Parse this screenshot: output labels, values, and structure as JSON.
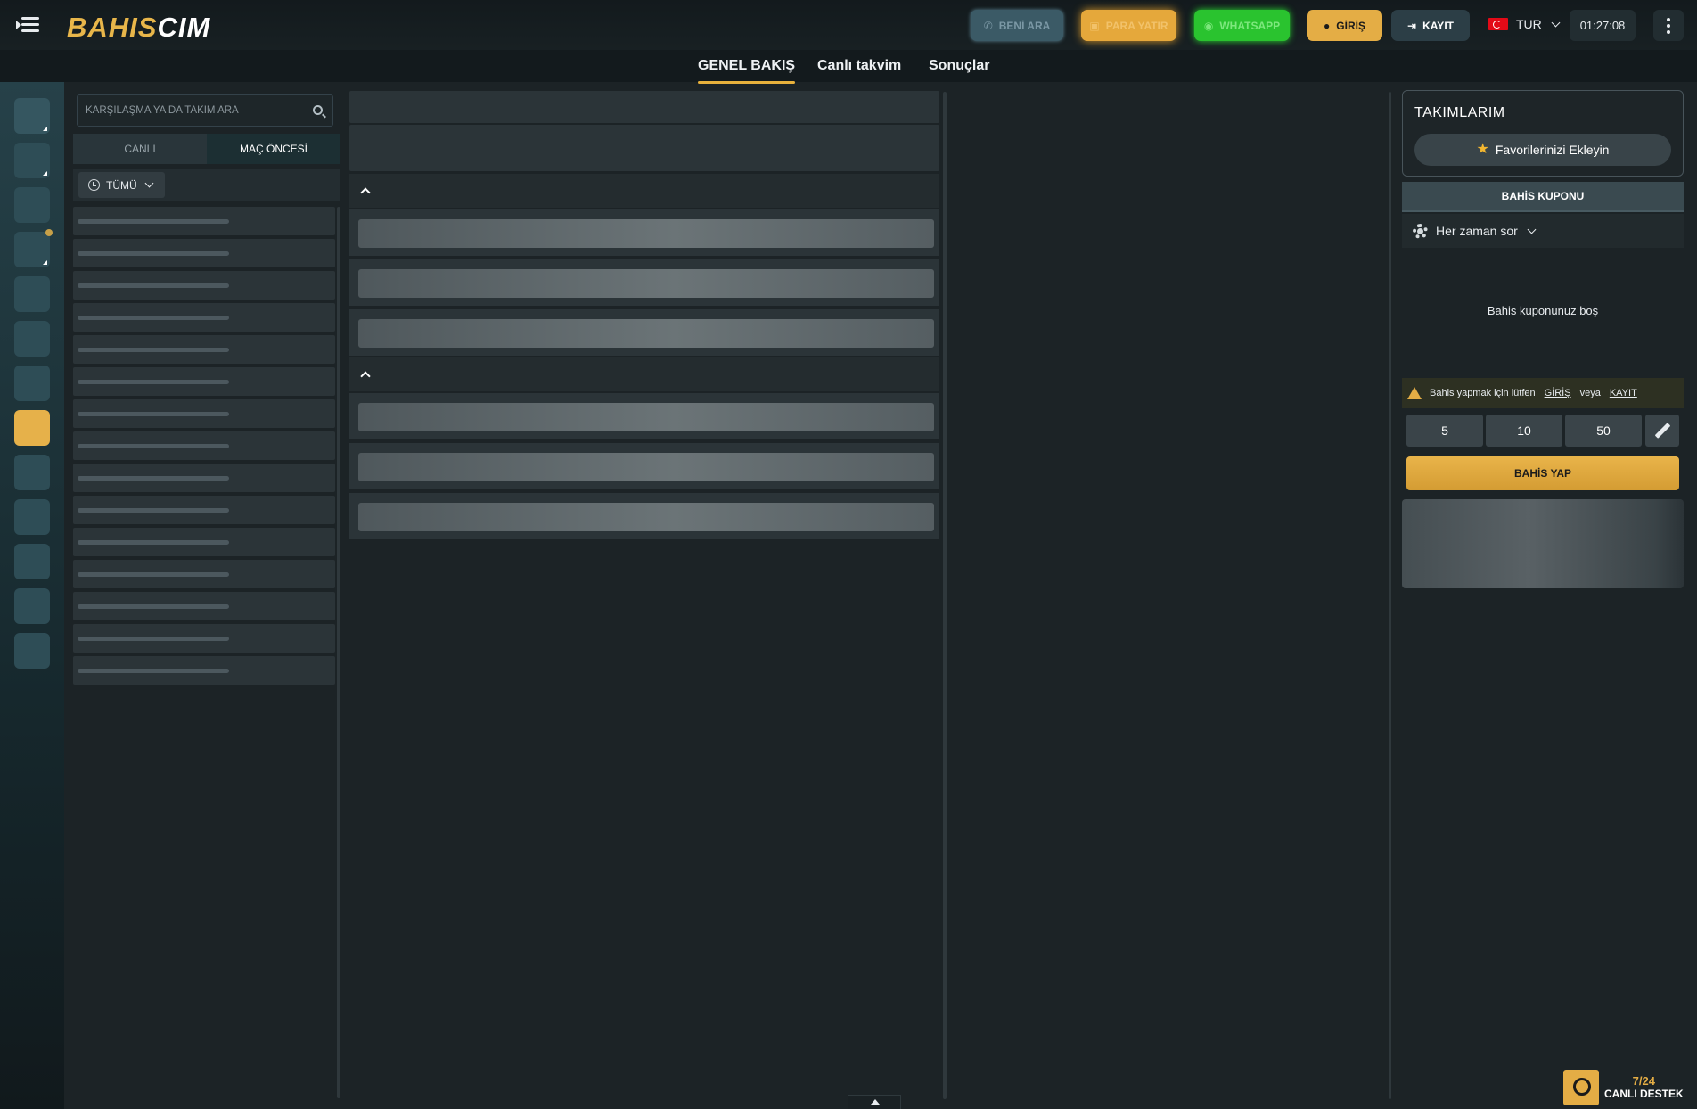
{
  "header": {
    "logo_part1": "BAHIS",
    "logo_part2": "CIM",
    "call_label": "BENİ ARA",
    "deposit_label": "PARA YATIR",
    "whatsapp_label": "WHATSAPP",
    "login_label": "GİRİŞ",
    "register_label": "KAYIT",
    "language": "TUR",
    "time": "01:27:08"
  },
  "subnav": {
    "tabs": [
      {
        "label": "GENEL BAKIŞ",
        "active": true
      },
      {
        "label": "Canlı takvim",
        "active": false
      },
      {
        "label": "Sonuçlar",
        "active": false
      }
    ]
  },
  "left_panel": {
    "search_placeholder": "KARŞILAŞMA YA DA TAKIM ARA",
    "tabs": [
      "CANLI",
      "MAÇ ÖNCESİ"
    ],
    "active_tab": "MAÇ ÖNCESİ",
    "filter_label": "TÜMÜ"
  },
  "right_panel": {
    "teams_title": "TAKIMLARIM",
    "add_favorites": "Favorilerinizi Ekleyin",
    "coupon_title": "BAHİS KUPONU",
    "ask_option": "Her zaman sor",
    "empty_coupon": "Bahis kuponunuz boş",
    "warning_prefix": "Bahis yapmak için lütfen",
    "warning_login": "GİRİŞ",
    "warning_or": "veya",
    "warning_register": "KAYIT",
    "stakes": [
      "5",
      "10",
      "50"
    ],
    "bet_button": "BAHİS YAP"
  },
  "support": {
    "line1": "7/24",
    "line2": "CANLI DESTEK"
  },
  "colors": {
    "accent": "#e4ad45",
    "whatsapp": "#2ac32f",
    "background": "#1c2326"
  }
}
